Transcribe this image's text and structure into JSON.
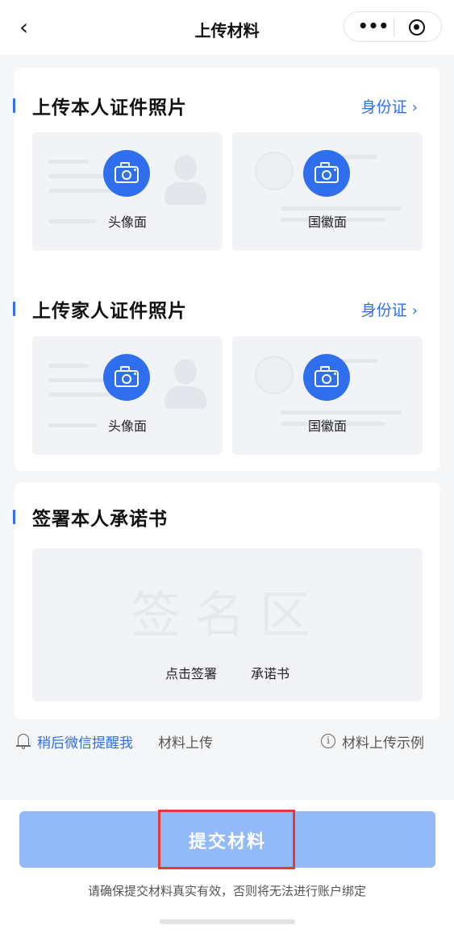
{
  "nav": {
    "back_icon": "chevron-left-icon",
    "title": "上传材料",
    "more_icon": "more-dots-icon",
    "target_icon": "record-target-icon"
  },
  "self_id": {
    "title": "上传本人证件照片",
    "doc_type": "身份证",
    "front_label": "头像面",
    "back_label": "国徽面"
  },
  "family_id": {
    "title": "上传家人证件照片",
    "doc_type": "身份证",
    "front_label": "头像面",
    "back_label": "国徽面"
  },
  "signature": {
    "title": "签署本人承诺书",
    "placeholder": "签名区",
    "hint_part1": "点击签署",
    "hint_part2": "承诺书"
  },
  "reminder": {
    "link": "稍后微信提醒我",
    "text": "材料上传"
  },
  "example": {
    "label": "材料上传示例"
  },
  "footer": {
    "submit_label": "提交材料",
    "note": "请确保提交材料真实有效，否则将无法进行账户绑定"
  },
  "colors": {
    "accent": "#2f6fed",
    "submit_bg": "#92b9f8",
    "highlight": "#e53935",
    "page_bg": "#f5f6f8"
  }
}
